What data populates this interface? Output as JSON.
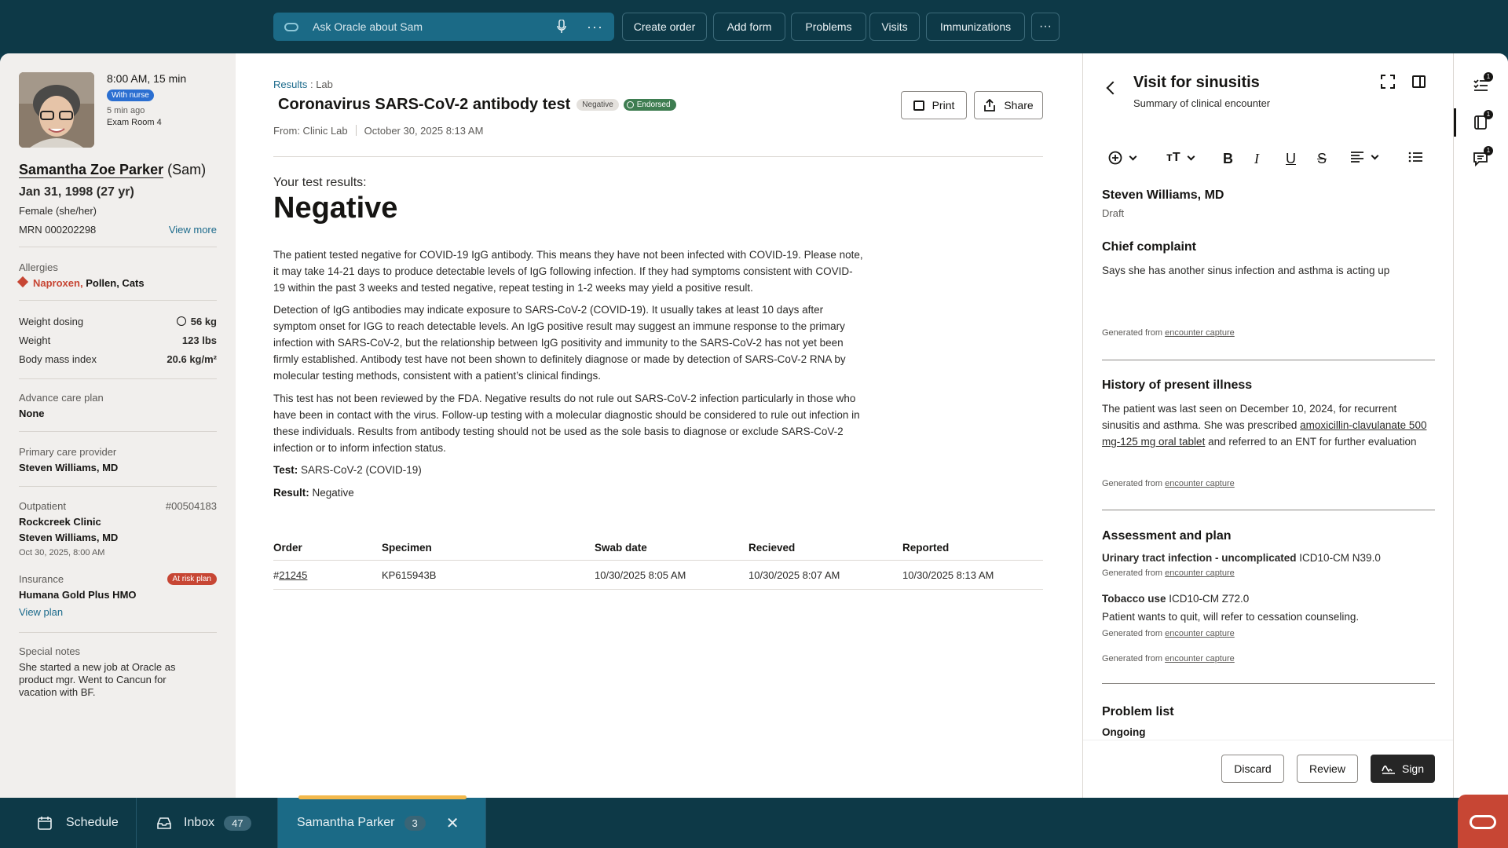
{
  "topbar": {
    "search_placeholder": "Ask Oracle about Sam",
    "more": "···",
    "buttons": [
      "Create order",
      "Add form",
      "Problems",
      "Visits",
      "Immunizations"
    ],
    "overflow": "···"
  },
  "patient": {
    "appt_time": "8:00 AM, 15 min",
    "with_nurse": "With nurse",
    "ago": "5 min ago",
    "room": "Exam Room 4",
    "name": "Samantha Zoe Parker",
    "nickname": "(Sam)",
    "dob": "Jan 31, 1998 (27 yr)",
    "sex": "Female (she/her)",
    "mrn": "MRN 000202298",
    "view_more": "View more",
    "allergies_label": "Allergies",
    "allergy_primary": "Naproxen,",
    "allergy_others": "Pollen, Cats",
    "weight_dosing_label": "Weight dosing",
    "weight_dosing": "56 kg",
    "weight_label": "Weight",
    "weight": "123 lbs",
    "bmi_label": "Body mass index",
    "bmi": "20.6 kg/m²",
    "acp_label": "Advance care plan",
    "acp": "None",
    "pcp_label": "Primary care provider",
    "pcp": "Steven Williams, MD",
    "outpatient_label": "Outpatient",
    "encounter_no": "#00504183",
    "clinic": "Rockcreek Clinic",
    "clinic_provider": "Steven Williams, MD",
    "clinic_time": "Oct 30, 2025, 8:00 AM",
    "insurance_label": "Insurance",
    "at_risk": "At risk plan",
    "insurance": "Humana Gold Plus HMO",
    "view_plan": "View plan",
    "notes_label": "Special notes",
    "notes": "She started a new job at Oracle as product mgr. Went to Cancun for vacation with BF."
  },
  "result": {
    "crumb_link": "Results",
    "crumb_rest": " : Lab",
    "title": "Coronavirus SARS-CoV-2 antibody test",
    "chip_negative": "Negative",
    "chip_endorsed": "Endorsed",
    "from": "From: Clinic Lab",
    "date": "October 30, 2025  8:13 AM",
    "print": "Print",
    "share": "Share",
    "your_results": "Your test results:",
    "big_result": "Negative",
    "para1": "The patient tested negative for COVID-19 IgG antibody. This means they have not been infected with COVID-19. Please note, it may take 14-21 days to produce detectable levels of IgG following infection. If they had symptoms consistent with COVID-19 within the past 3 weeks and tested negative, repeat testing in 1-2 weeks may yield a positive result.",
    "para2": "Detection of IgG antibodies may indicate exposure to SARS-CoV-2 (COVID-19). It usually takes at least 10 days after symptom onset for IGG to reach detectable levels. An IgG positive result may suggest an immune response to the primary infection with SARS-CoV-2, but the relationship between IgG positivity and immunity to the SARS-CoV-2 has not yet been firmly established. Antibody test have not been shown to definitely diagnose or made by detection of SARS-CoV-2 RNA by molecular testing methods, consistent with a patient’s clinical findings.",
    "para3": "This test has not been reviewed by the FDA. Negative results do not rule out SARS-CoV-2 infection particularly in those who have been in contact with the virus. Follow-up testing with a molecular diagnostic should be considered to rule out infection in these individuals. Results from antibody testing should not be used as the sole basis to diagnose or exclude SARS-CoV-2 infection or to inform infection status.",
    "test_label": "Test:",
    "test_value": " SARS-CoV-2 (COVID-19)",
    "result_label": "Result:",
    "result_value": " Negative",
    "table": {
      "headers": [
        "Order",
        "Specimen",
        "Swab date",
        "Recieved",
        "Reported"
      ],
      "row": {
        "order_hash": "#",
        "order": "21245",
        "specimen": "KP615943B",
        "swab": "10/30/2025  8:05 AM",
        "received": "10/30/2025  8:07 AM",
        "reported": "10/30/2025  8:13 AM"
      }
    }
  },
  "note": {
    "title": "Visit for sinusitis",
    "subtitle": "Summary of clinical encounter",
    "author": "Steven Williams, MD",
    "status": "Draft",
    "generated_prefix": "Generated from ",
    "generated_link": "encounter capture",
    "cc_head": "Chief complaint",
    "cc_text": "Says she has another sinus infection and asthma is acting up",
    "hpi_head": "History of present illness",
    "hpi_text_1": "The patient was last seen on December 10, 2024, for recurrent sinusitis and asthma. She was prescribed ",
    "hpi_link": "amoxicillin-clavulanate 500 mg-125 mg oral tablet",
    "hpi_text_2": " and referred to an ENT for further evaluation",
    "ap_head": "Assessment and plan",
    "ap1_bold": "Urinary tract infection - uncomplicated",
    "ap1_code": " ICD10-CM N39.0",
    "ap2_bold": "Tobacco use",
    "ap2_code": " ICD10-CM Z72.0",
    "ap2_text": "Patient wants to quit, will refer to cessation counseling.",
    "pl_head": "Problem list",
    "pl_ongoing": "Ongoing",
    "discard": "Discard",
    "review": "Review",
    "sign": "Sign"
  },
  "rail": {
    "badge1": "1",
    "badge2": "1",
    "badge3": "1"
  },
  "bottombar": {
    "schedule": "Schedule",
    "inbox": "Inbox",
    "inbox_count": "47",
    "patient_tab": "Samantha Parker",
    "patient_count": "3",
    "close": "✕"
  },
  "colors": {
    "brand_red": "#c74634",
    "nav_teal": "#0d3947",
    "accent_blue": "#1b6a86"
  }
}
